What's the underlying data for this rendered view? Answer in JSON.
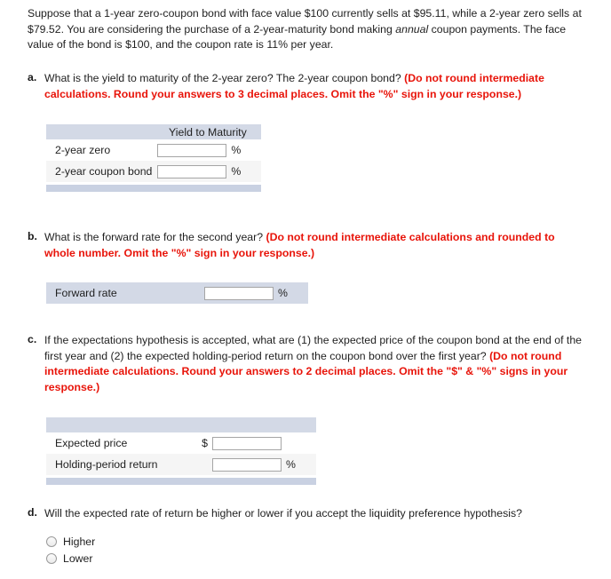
{
  "intro": {
    "part1": "Suppose that a 1-year zero-coupon bond with face value $100 currently sells at $95.11, while a 2-year zero sells at $79.52. You are considering the purchase of a 2-year-maturity bond making ",
    "italic_word": "annual",
    "part2": " coupon payments. The face value of the bond is $100, and the coupon rate is 11% per year."
  },
  "colors": {
    "instruction_red": "#e8140a",
    "header_band": "#d3d9e6",
    "footer_band": "#c9d1e2",
    "row_alt": "#f5f5f5",
    "input_border": "#a5a5a5"
  },
  "questions": {
    "a": {
      "letter": "a.",
      "prompt": "What is the yield to maturity of the 2-year zero? The 2-year coupon bond? ",
      "instruction": "(Do not round intermediate calculations. Round your answers to 3 decimal places. Omit the \"%\" sign in your response.)",
      "table": {
        "header": "Yield to Maturity",
        "rows": [
          {
            "label": "2-year zero",
            "value": "",
            "unit": "%",
            "prefix": ""
          },
          {
            "label": "2-year coupon bond",
            "value": "",
            "unit": "%",
            "prefix": ""
          }
        ]
      }
    },
    "b": {
      "letter": "b.",
      "prompt": "What is the forward rate for the second year? ",
      "instruction": "(Do not round intermediate calculations and rounded to whole number. Omit the \"%\" sign in your response.)",
      "table": {
        "header": "",
        "rows": [
          {
            "label": "Forward rate",
            "value": "",
            "unit": "%",
            "prefix": ""
          }
        ]
      }
    },
    "c": {
      "letter": "c.",
      "prompt": "If the expectations hypothesis is accepted, what are (1) the expected price of the coupon bond at the end of the first year and (2) the expected holding-period return on the coupon bond over the first year? ",
      "instruction": "(Do not round intermediate calculations. Round your answers to 2 decimal places. Omit the \"$\" & \"%\" signs in your response.)",
      "table": {
        "header": "",
        "rows": [
          {
            "label": "Expected price",
            "value": "",
            "unit": "",
            "prefix": "$"
          },
          {
            "label": "Holding-period return",
            "value": "",
            "unit": "%",
            "prefix": ""
          }
        ]
      }
    },
    "d": {
      "letter": "d.",
      "prompt": "Will the expected rate of return be higher or lower if you accept the liquidity preference hypothesis?",
      "instruction": "",
      "options": [
        {
          "label": "Higher",
          "selected": false
        },
        {
          "label": "Lower",
          "selected": false
        }
      ]
    }
  }
}
